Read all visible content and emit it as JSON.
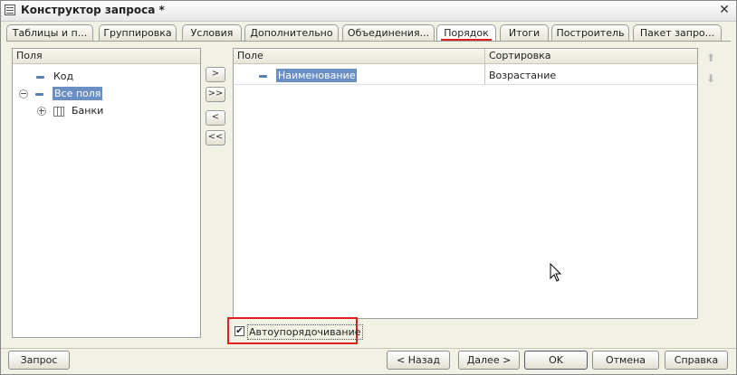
{
  "window": {
    "title": "Конструктор запроса *"
  },
  "tabs": [
    {
      "label": "Таблицы и п..."
    },
    {
      "label": "Группировка"
    },
    {
      "label": "Условия"
    },
    {
      "label": "Дополнительно"
    },
    {
      "label": "Объединения..."
    },
    {
      "label": "Порядок",
      "active": true
    },
    {
      "label": "Итоги"
    },
    {
      "label": "Построитель"
    },
    {
      "label": "Пакет запро..."
    }
  ],
  "fields_panel": {
    "header": "Поля",
    "items": [
      {
        "label": "Код"
      },
      {
        "label": "Все поля"
      },
      {
        "label": "Банки"
      }
    ]
  },
  "transfer_buttons": {
    "add": ">",
    "add_all": ">>",
    "remove": "<",
    "remove_all": "<<"
  },
  "order_panel": {
    "columns": [
      "Поле",
      "Сортировка"
    ],
    "rows": [
      {
        "field": "Наименование",
        "sort": "Возрастание"
      }
    ]
  },
  "move_buttons": {
    "up_icon": "arrow-up-icon",
    "down_icon": "arrow-down-icon"
  },
  "auto_order": {
    "label": "Автоупорядочивание",
    "checked": true
  },
  "footer": {
    "query": "Запрос",
    "back": "< Назад",
    "next": "Далее >",
    "ok": "OK",
    "cancel": "Отмена",
    "help": "Справка"
  },
  "accent_colors": {
    "highlight": "#e02020",
    "selection": "#6a8fc4"
  }
}
